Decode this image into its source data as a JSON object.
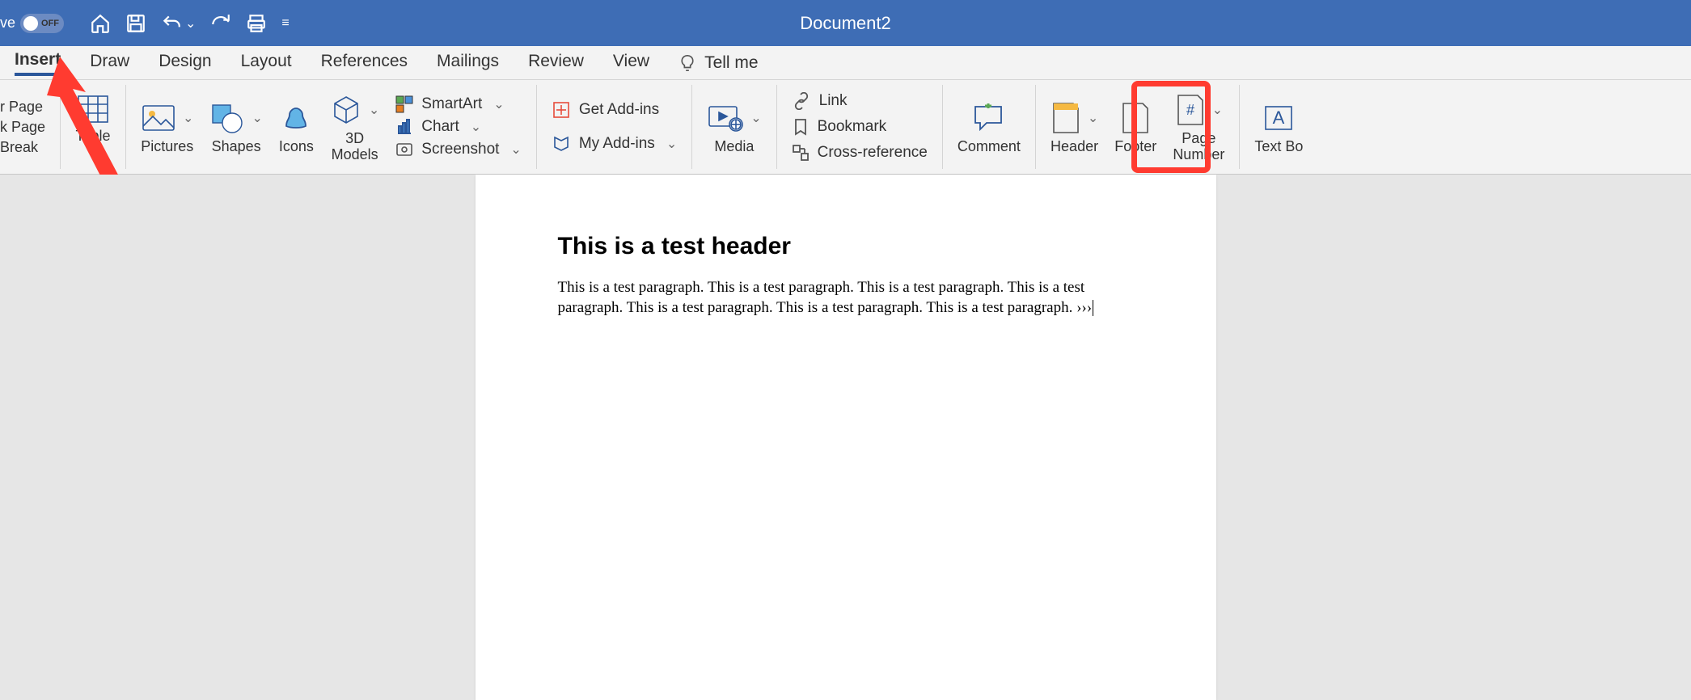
{
  "titlebar": {
    "autosave_label": "ve",
    "toggle_state": "OFF",
    "document_name": "Document2"
  },
  "tabs": [
    "Insert",
    "Draw",
    "Design",
    "Layout",
    "References",
    "Mailings",
    "Review",
    "View"
  ],
  "active_tab": "Insert",
  "tellme_label": "Tell me",
  "ribbon": {
    "pages": {
      "cover": "r Page",
      "blank": "k Page",
      "break": "Break"
    },
    "table": "Table",
    "pictures": "Pictures",
    "shapes": "Shapes",
    "icons": "Icons",
    "models": "3D\nModels",
    "smartart": "SmartArt",
    "chart": "Chart",
    "screenshot": "Screenshot",
    "getaddins": "Get Add-ins",
    "myaddins": "My Add-ins",
    "media": "Media",
    "link": "Link",
    "bookmark": "Bookmark",
    "crossref": "Cross-reference",
    "comment": "Comment",
    "header": "Header",
    "footer": "Footer",
    "pagenum": "Page\nNumber",
    "textbox": "Text Bo"
  },
  "document": {
    "header": "This is a test header",
    "paragraph": "This is a test paragraph. This is a test paragraph. This is a test paragraph. This is a test paragraph. This is a test paragraph. This is a test paragraph. This is a test paragraph. ›››"
  }
}
